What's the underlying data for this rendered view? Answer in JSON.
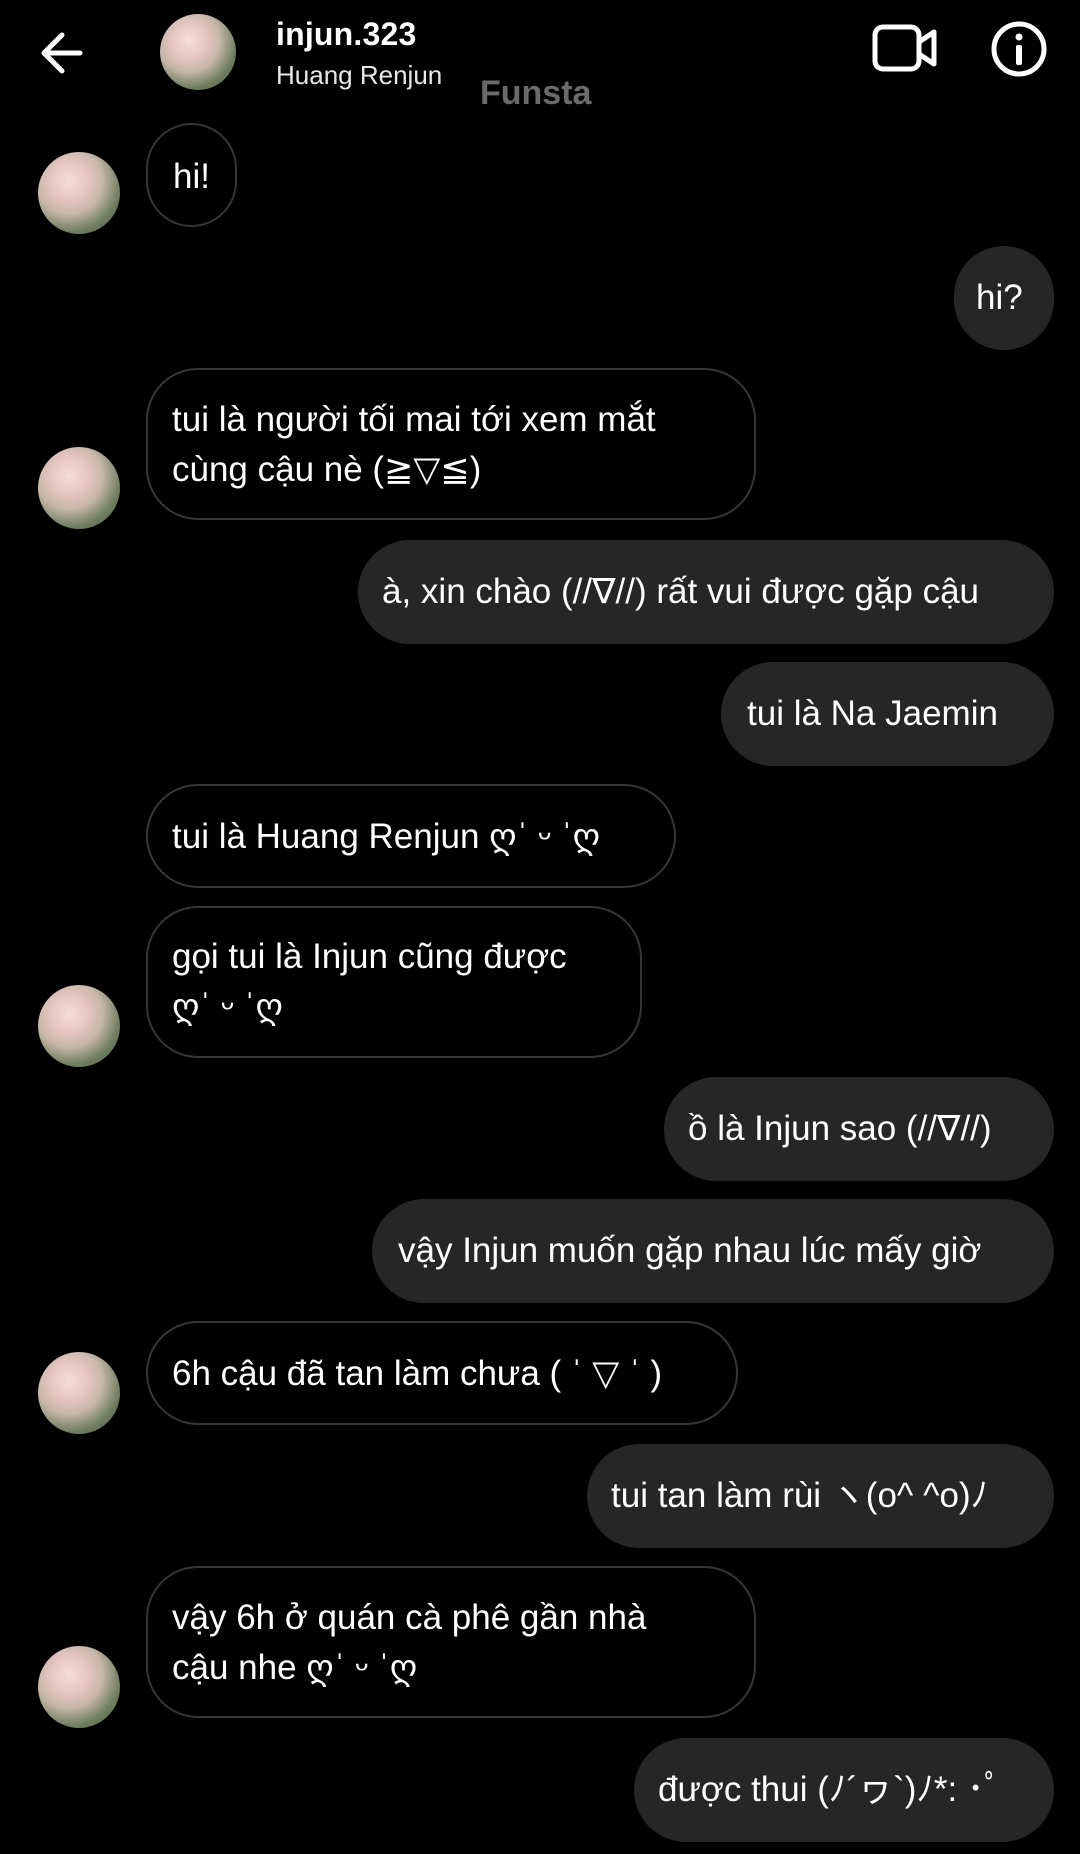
{
  "header": {
    "username": "injun.323",
    "full_name": "Huang Renjun",
    "watermark": "Funsta",
    "back_icon": "arrow-left-icon",
    "video_icon": "video-camera-icon",
    "info_icon": "info-icon"
  },
  "colors": {
    "background": "#000000",
    "outgoing_bubble": "#262626",
    "incoming_border": "#363636",
    "watermark": "#6b6b6b"
  },
  "messages": [
    {
      "sender": "other",
      "text": "hi!"
    },
    {
      "sender": "me",
      "text": "hi?"
    },
    {
      "sender": "other",
      "lines": [
        "tui là người tối mai tới xem mắt",
        "cùng cậu nè (≧▽≦)"
      ]
    },
    {
      "sender": "me",
      "text": "à, xin chào (//∇//) rất vui được gặp cậu"
    },
    {
      "sender": "me",
      "text": "tui là Na Jaemin"
    },
    {
      "sender": "other",
      "text": "tui là Huang Renjun ღˈ ᵕ ˈღ"
    },
    {
      "sender": "other",
      "lines": [
        "gọi tui là Injun cũng được",
        "ღˈ ᵕ ˈღ"
      ]
    },
    {
      "sender": "me",
      "text": "ồ là Injun sao (//∇//)"
    },
    {
      "sender": "me",
      "text": "vậy Injun muốn gặp nhau lúc mấy giờ"
    },
    {
      "sender": "other",
      "text": "6h cậu đã tan làm chưa ( ˈ ▽ ˈ )"
    },
    {
      "sender": "me",
      "text": "tui tan làm rùi ヽ(o^ ^o)ﾉ"
    },
    {
      "sender": "other",
      "lines": [
        "vậy 6h ở quán cà phê gần nhà",
        "cậu nhe ღˈ ᵕ ˈღ"
      ]
    },
    {
      "sender": "me",
      "text": "được thui (ﾉ´ヮ`)ﾉ*: ･ﾟ"
    }
  ]
}
